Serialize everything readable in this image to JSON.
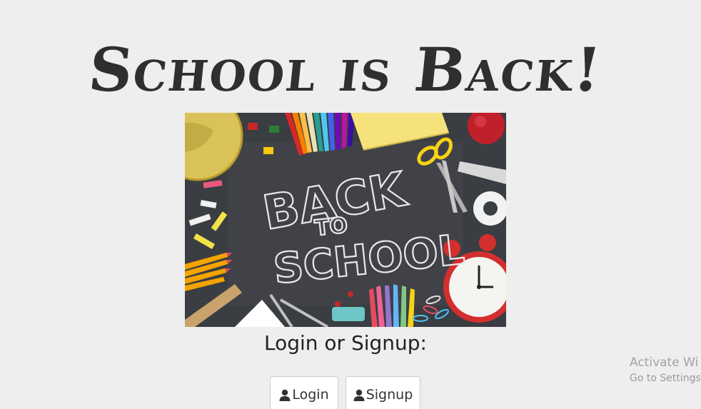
{
  "header": {
    "title": "School is Back!"
  },
  "hero": {
    "line1": "BACK",
    "line2": "TO",
    "line3": "SCHOOL"
  },
  "auth": {
    "prompt": "Login or Signup:",
    "login_label": "Login",
    "signup_label": "Signup",
    "icon": "user-icon"
  },
  "watermark": {
    "title": "Activate Wi",
    "subtitle": "Go to Settings t"
  },
  "colors": {
    "background": "#eeeeee",
    "title": "#2f2f2f",
    "chalkboard": "#3a3d42",
    "chalk": "#e8e8e8",
    "button_border": "#cccccc"
  }
}
